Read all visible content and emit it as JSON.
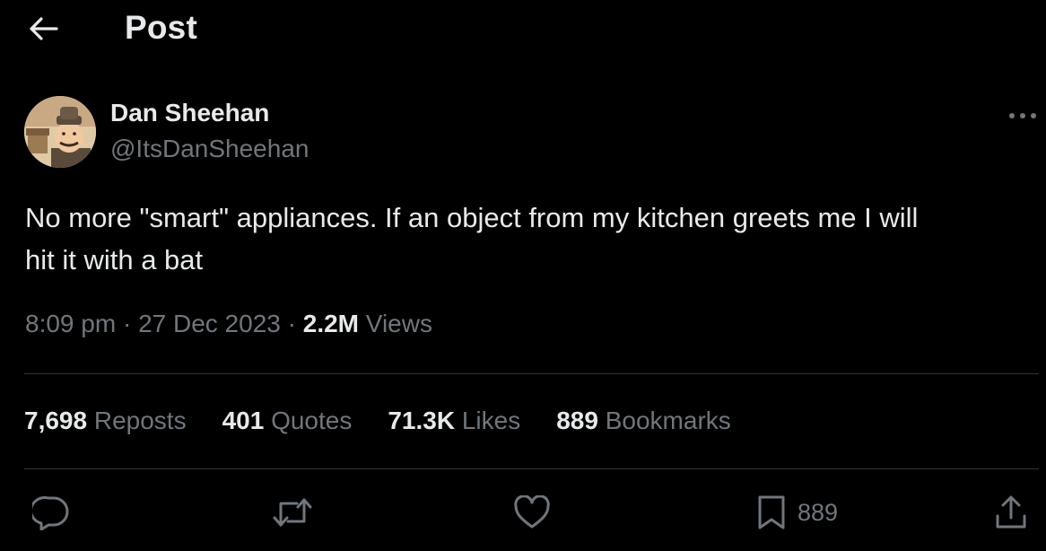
{
  "header": {
    "back_icon": "arrow-left-icon",
    "title": "Post"
  },
  "author": {
    "name": "Dan Sheehan",
    "handle": "@ItsDanSheehan",
    "more_icon": "more-horizontal-icon"
  },
  "tweet": {
    "text_line1": "No more \"smart\" appliances. If an object from my kitchen greets me I will",
    "text_line2": "hit it with a bat"
  },
  "meta": {
    "time": "8:09 pm",
    "separator": "·",
    "date": "27 Dec 2023",
    "views_count": "2.2M",
    "views_label": "Views"
  },
  "stats": [
    {
      "count": "7,698",
      "label": "Reposts"
    },
    {
      "count": "401",
      "label": "Quotes"
    },
    {
      "count": "71.3K",
      "label": "Likes"
    },
    {
      "count": "889",
      "label": "Bookmarks"
    }
  ],
  "actions": {
    "reply_icon": "reply-icon",
    "repost_icon": "repost-icon",
    "like_icon": "heart-icon",
    "bookmark_icon": "bookmark-icon",
    "bookmark_count": "889",
    "share_icon": "share-icon"
  },
  "colors": {
    "background": "#000000",
    "primary_text": "#e7e9ea",
    "secondary_text": "#71767b",
    "divider": "#2f3336"
  }
}
